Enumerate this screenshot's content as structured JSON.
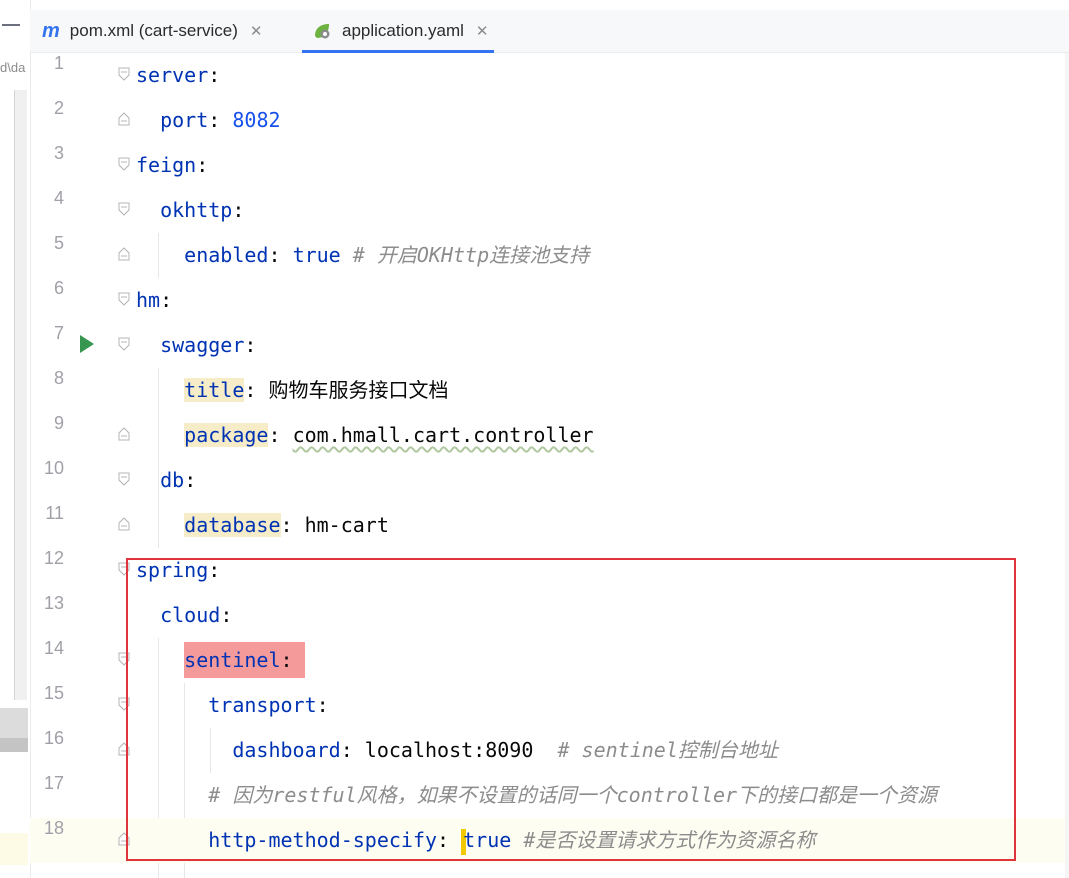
{
  "left_panel": {
    "breadcrumb_fragment": "d\\da"
  },
  "tabs": [
    {
      "label": "pom.xml (cart-service)",
      "icon": "maven-m-icon",
      "active": false
    },
    {
      "label": "application.yaml",
      "icon": "spring-leaf-icon",
      "active": true
    }
  ],
  "colors": {
    "accent": "#3574f0",
    "key": "#0033b3",
    "number": "#1750eb",
    "comment": "#8c8c8c",
    "highlight_box": "#e0333a",
    "sentinel_highlight": "#f59a9a"
  },
  "editor": {
    "lines": [
      {
        "num": "1",
        "key": "server"
      },
      {
        "num": "2",
        "key": "port",
        "value": "8082"
      },
      {
        "num": "3",
        "key": "feign"
      },
      {
        "num": "4",
        "key": "okhttp"
      },
      {
        "num": "5",
        "key": "enabled",
        "value": "true",
        "comment": "# 开启OKHttp连接池支持"
      },
      {
        "num": "6",
        "key": "hm"
      },
      {
        "num": "7",
        "key": "swagger"
      },
      {
        "num": "8",
        "key": "title",
        "value": "购物车服务接口文档"
      },
      {
        "num": "9",
        "key": "package",
        "value": "com.hmall.cart.controller"
      },
      {
        "num": "10",
        "key": "db"
      },
      {
        "num": "11",
        "key": "database",
        "value": "hm-cart"
      },
      {
        "num": "12",
        "key": "spring"
      },
      {
        "num": "13",
        "key": "cloud"
      },
      {
        "num": "14",
        "key": "sentinel"
      },
      {
        "num": "15",
        "key": "transport"
      },
      {
        "num": "16",
        "key": "dashboard",
        "value": "localhost:8090",
        "comment": "# sentinel控制台地址"
      },
      {
        "num": "17",
        "comment": "# 因为restful风格，如果不设置的话同一个controller下的接口都是一个资源"
      },
      {
        "num": "18",
        "key": "http-method-specify",
        "value": "true",
        "comment": "#是否设置请求方式作为资源名称"
      }
    ]
  }
}
